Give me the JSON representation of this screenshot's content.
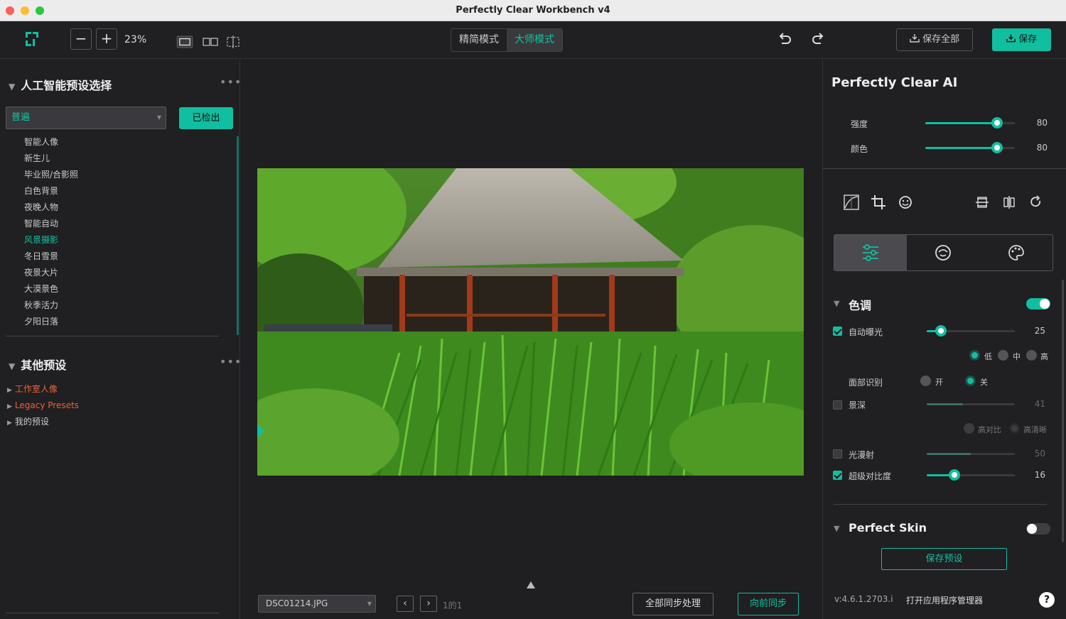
{
  "window": {
    "title": "Perfectly Clear Workbench v4"
  },
  "toolbar": {
    "zoom": "23%",
    "mode_simple": "精简模式",
    "mode_master": "大师模式",
    "save_all": "保存全部",
    "save": "保存"
  },
  "left": {
    "ai_title": "人工智能预设选择",
    "dropdown_value": "普遍",
    "detect_btn": "已检出",
    "presets": [
      "智能人像",
      "新生儿",
      "毕业照/合影照",
      "白色背景",
      "夜晚人物",
      "智能自动",
      "风景摄影",
      "冬日雪景",
      "夜景大片",
      "大漠景色",
      "秋季活力",
      "夕阳日落"
    ],
    "active_preset": "风景摄影",
    "other_title": "其他预设",
    "groups": [
      {
        "label": "工作室人像",
        "color": "#e8643a"
      },
      {
        "label": "Legacy Presets",
        "color": "#e8643a"
      },
      {
        "label": "我的预设",
        "color": "#cccccc"
      }
    ]
  },
  "center": {
    "filename": "DSC01214.JPG",
    "page": "1的1",
    "sync_all": "全部同步处理",
    "sync_forward": "向前同步"
  },
  "right": {
    "title": "Perfectly Clear AI",
    "strength_label": "强度",
    "strength_value": "80",
    "strength": 0.8,
    "color_label": "颜色",
    "color_value": "80",
    "color": 0.8,
    "tone_title": "色调",
    "auto_exposure": "自动曝光",
    "auto_exposure_value": "25",
    "low": "低",
    "mid": "中",
    "high": "高",
    "face_detect": "面部识别",
    "on": "开",
    "off": "关",
    "depth": "景深",
    "depth_value": "41",
    "high_contrast": "高对比",
    "high_clarity": "高清晰",
    "light_diffuse": "光漫射",
    "light_diffuse_value": "50",
    "super_contrast": "超级对比度",
    "super_contrast_value": "16",
    "skin_title": "Perfect Skin",
    "save_preset": "保存预设",
    "version": "v:4.6.1.2703.i",
    "app_manager": "打开应用程序管理器",
    "help": "?"
  },
  "colors": {
    "accent": "#10bfa0",
    "orange": "#e8643a",
    "bg": "#201f22"
  }
}
